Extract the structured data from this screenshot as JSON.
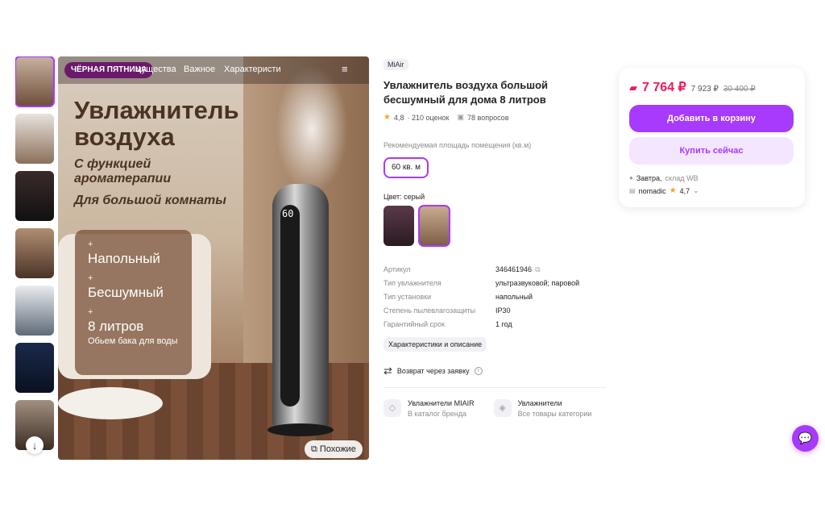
{
  "gallery": {
    "thumbnails": [
      "thumb-1",
      "thumb-2",
      "thumb-3",
      "thumb-4",
      "thumb-5",
      "thumb-6",
      "thumb-7"
    ],
    "scroll_icon": "arrow-down-icon",
    "hero": {
      "badge": "ЧЁРНАЯ ПЯТНИЦА",
      "nav_items": [
        "мущества",
        "Важное",
        "Характеристи"
      ],
      "title_line1": "Увлажнитель",
      "title_line2": "воздуха",
      "sub_line1": "С функцией",
      "sub_line2": "ароматерапии",
      "sub_line3": "Для большой комнаты",
      "features": [
        "Напольный",
        "Бесшумный",
        "8 литров"
      ],
      "feature_note": "Обьем бака для воды",
      "display_value": "60",
      "similar_label": "Похожие"
    }
  },
  "product": {
    "brand": "MiAir",
    "title": "Увлажнитель воздуха большой бесшумный для дома 8 литров",
    "rating": "4,8",
    "reviews": "· 210 оценок",
    "questions": "78 вопросов",
    "area_label": "Рекомендуемая площадь помещения (кв.м)",
    "area_value": "60 кв. м",
    "color_label": "Цвет: серый",
    "specs": [
      {
        "key": "Артикул",
        "value": "346461946"
      },
      {
        "key": "Тип увлажнителя",
        "value": "ультразвуковой; паровой"
      },
      {
        "key": "Тип установки",
        "value": "напольный"
      },
      {
        "key": "Степень пылевлагозащиты",
        "value": "IP30"
      },
      {
        "key": "Гарантийный срок",
        "value": "1 год"
      }
    ],
    "chars_button": "Характеристики и описание",
    "return_label": "Возврат через заявку",
    "categories": [
      {
        "title": "Увлажнители MIAIR",
        "sub": "В каталог бренда",
        "icon": "tag-icon"
      },
      {
        "title": "Увлажнители",
        "sub": "Все товары категории",
        "icon": "category-icon"
      }
    ]
  },
  "buy": {
    "price": "7 764 ₽",
    "price_alt": "7 923 ₽",
    "price_old": "30 400 ₽",
    "cart_label": "Добавить в корзину",
    "buy_label": "Купить сейчас",
    "delivery": "Завтра,",
    "warehouse": "склад WB",
    "seller": "nomadic",
    "seller_rating": "4,7"
  },
  "colors": {
    "accent": "#a73afd",
    "price": "#f0185b"
  }
}
